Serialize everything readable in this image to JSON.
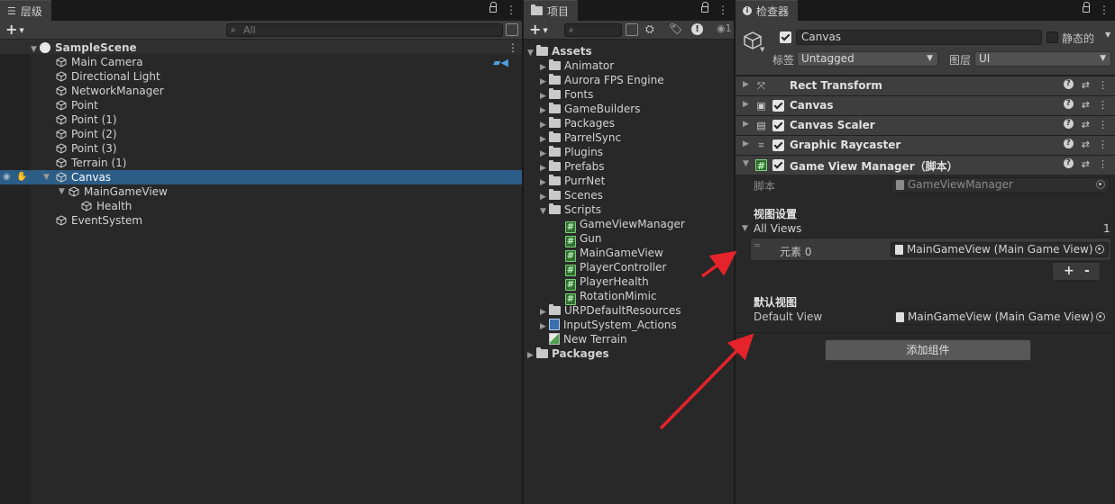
{
  "hierarchy": {
    "tab_label": "层级",
    "search_placeholder": "All",
    "scene_name": "SampleScene",
    "items": [
      {
        "label": "Main Camera"
      },
      {
        "label": "Directional Light"
      },
      {
        "label": "NetworkManager"
      },
      {
        "label": "Point"
      },
      {
        "label": "Point (1)"
      },
      {
        "label": "Point (2)"
      },
      {
        "label": "Point (3)"
      },
      {
        "label": "Terrain (1)"
      },
      {
        "label": "Canvas"
      },
      {
        "label": "MainGameView"
      },
      {
        "label": "Health"
      },
      {
        "label": "EventSystem"
      }
    ],
    "selected_item": "Canvas"
  },
  "project": {
    "tab_label": "项目",
    "hidden_count": "1",
    "tree": [
      {
        "label": "Assets",
        "kind": "root-open"
      },
      {
        "label": "Animator",
        "kind": "folder"
      },
      {
        "label": "Aurora FPS Engine",
        "kind": "folder"
      },
      {
        "label": "Fonts",
        "kind": "folder"
      },
      {
        "label": "GameBuilders",
        "kind": "folder"
      },
      {
        "label": "Packages",
        "kind": "folder"
      },
      {
        "label": "ParrelSync",
        "kind": "folder"
      },
      {
        "label": "Plugins",
        "kind": "folder"
      },
      {
        "label": "Prefabs",
        "kind": "folder"
      },
      {
        "label": "PurrNet",
        "kind": "folder"
      },
      {
        "label": "Scenes",
        "kind": "folder"
      },
      {
        "label": "Scripts",
        "kind": "folder-open"
      },
      {
        "label": "GameViewManager",
        "kind": "script"
      },
      {
        "label": "Gun",
        "kind": "script"
      },
      {
        "label": "MainGameView",
        "kind": "script"
      },
      {
        "label": "PlayerController",
        "kind": "script"
      },
      {
        "label": "PlayerHealth",
        "kind": "script"
      },
      {
        "label": "RotationMimic",
        "kind": "script"
      },
      {
        "label": "URPDefaultResources",
        "kind": "folder"
      },
      {
        "label": "InputSystem_Actions",
        "kind": "asset"
      },
      {
        "label": "New Terrain",
        "kind": "terrain"
      },
      {
        "label": "Packages",
        "kind": "root"
      }
    ]
  },
  "inspector": {
    "tab_label": "检查器",
    "object_name": "Canvas",
    "static_label": "静态的",
    "tag_label": "标签",
    "tag_value": "Untagged",
    "layer_label": "图层",
    "layer_value": "UI",
    "components": [
      {
        "title": "Rect Transform",
        "icon": "rect-transform-icon"
      },
      {
        "title": "Canvas",
        "icon": "canvas-icon"
      },
      {
        "title": "Canvas Scaler",
        "icon": "canvas-scaler-icon"
      },
      {
        "title": "Graphic Raycaster",
        "icon": "raycaster-icon"
      },
      {
        "title": "Game View Manager（脚本）",
        "icon": "script-icon"
      }
    ],
    "script_label": "脚本",
    "script_value": "GameViewManager",
    "view_settings_header": "视图设置",
    "all_views_label": "All Views",
    "all_views_count": "1",
    "element_label": "元素 0",
    "element_value": "MainGameView (Main Game View)",
    "add_label": "+",
    "remove_label": "-",
    "default_view_header": "默认视图",
    "default_view_label": "Default View",
    "default_view_value": "MainGameView (Main Game View)",
    "add_component_label": "添加组件"
  },
  "colors": {
    "selection": "#2c5d87",
    "annotation_arrow": "#e5232b"
  }
}
